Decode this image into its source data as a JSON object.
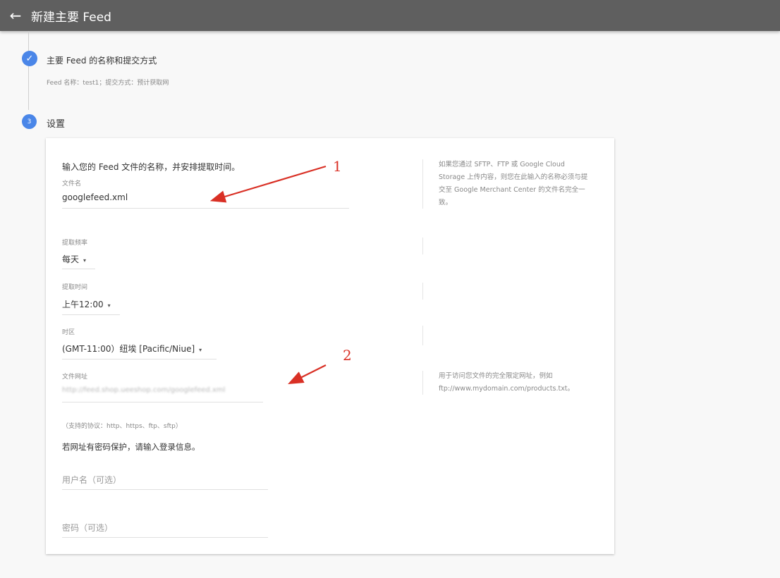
{
  "header": {
    "back_icon": "arrow-left-icon",
    "title": "新建主要 Feed"
  },
  "stepper": {
    "step1": {
      "title": "主要 Feed 的名称和提交方式",
      "summary": "Feed 名称：test1；提交方式：预计获取网"
    },
    "step3": {
      "number": "3",
      "title": "设置"
    }
  },
  "form": {
    "intro": "输入您的 Feed 文件的名称，并安排提取时间。",
    "file_name": {
      "label": "文件名",
      "value": "googlefeed.xml"
    },
    "file_name_help": "如果您通过 SFTP、FTP 或 Google Cloud Storage 上传内容，则您在此输入的名称必须与提交至 Google Merchant Center 的文件名完全一致。",
    "fetch_frequency": {
      "label": "提取频率",
      "value": "每天"
    },
    "fetch_time": {
      "label": "提取时间",
      "value": "上午12:00"
    },
    "timezone": {
      "label": "时区",
      "value": "(GMT-11:00）纽埃 [Pacific/Niue]"
    },
    "file_url": {
      "label": "文件网址",
      "value": "http://feed.shop.ueeshop.com/googlefeed.xml"
    },
    "file_url_help": "用于访问您文件的完全限定网址，例如 ftp://www.mydomain.com/products.txt。",
    "protocols": "（支持的协议：http、https、ftp、sftp）",
    "password_protected": "若网址有密码保护，请输入登录信息。",
    "username_placeholder": "用户名（可选）",
    "password_placeholder": "密码（可选）"
  },
  "annotations": {
    "one": "1",
    "two": "2"
  },
  "colors": {
    "accent": "#4a86e8",
    "arrow": "#d93025",
    "topbar": "#5f5f5f"
  }
}
